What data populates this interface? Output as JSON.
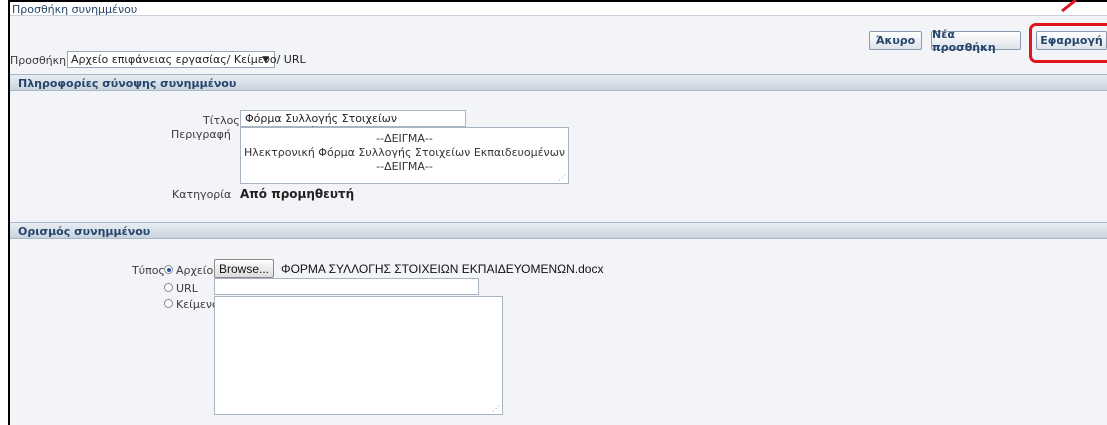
{
  "page": {
    "title": "Προσθήκη συνημμένου"
  },
  "toolbar": {
    "cancel": "Άκυρο",
    "add_new": "Νέα προσθήκη",
    "apply": "Εφαρμογή"
  },
  "add": {
    "label": "Προσθήκη",
    "selected": "Αρχείο επιφάνειας εργασίας/ Κείμενο/ URL"
  },
  "summary": {
    "header": "Πληροφορίες σύνοψης συνημμένου",
    "title_label": "Τίτλος",
    "title_value": "Φόρμα Συλλογής Στοιχείων Εκπαιδευομένων",
    "description_label": "Περιγραφή",
    "description_lines": [
      "--ΔΕΙΓΜΑ--",
      "Ηλεκτρονική Φόρμα Συλλογής Στοιχείων Εκπαιδευομένων",
      "--ΔΕΙΓΜΑ--"
    ],
    "category_label": "Κατηγορία",
    "category_value": "Από προμηθευτή"
  },
  "definition": {
    "header": "Ορισμός συνημμένου",
    "type_label": "Τύπος",
    "options": [
      "Αρχείο",
      "URL",
      "Κείμενο"
    ],
    "selected": "Αρχείο",
    "browse": "Browse...",
    "file_name": "ΦΟΡΜΑ ΣΥΛΛΟΓΗΣ ΣΤΟΙΧΕΙΩΝ ΕΚΠΑΙΔΕΥΟΜΕΝΩΝ.docx",
    "url_value": "",
    "text_value": ""
  },
  "colors": {
    "highlight": "#e2141b",
    "header_text": "#25456b"
  }
}
